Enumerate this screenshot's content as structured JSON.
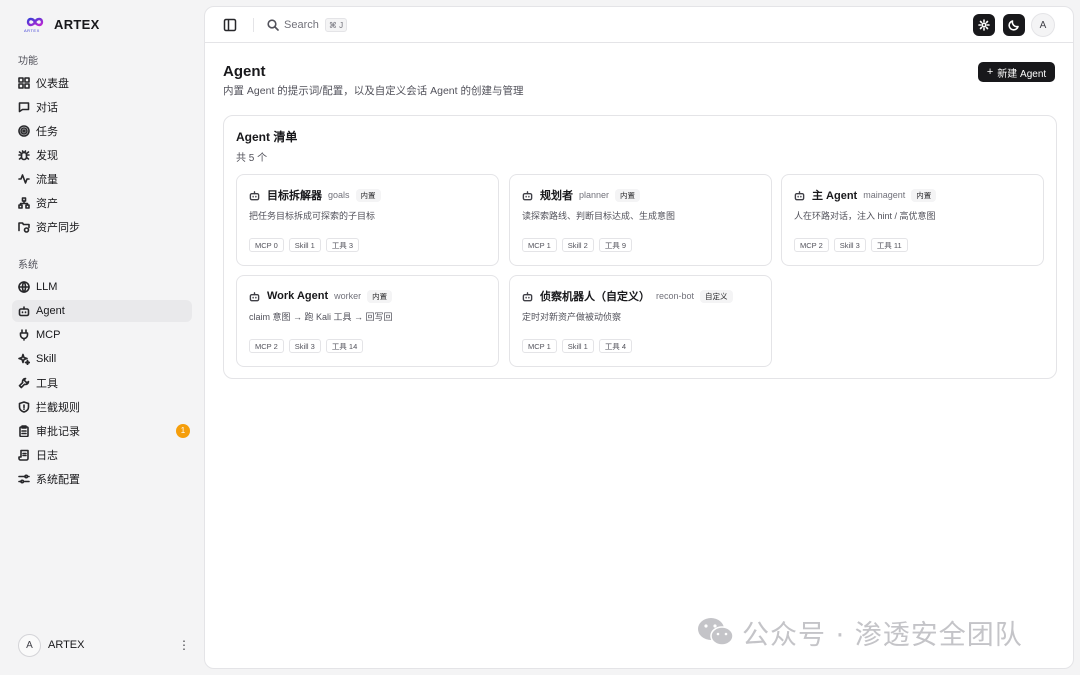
{
  "brand": {
    "name": "ARTEX",
    "logo_caption": "ARTEX"
  },
  "sidebar": {
    "sections": [
      {
        "title": "功能",
        "items": [
          {
            "label": "仪表盘",
            "icon": "dashboard-icon"
          },
          {
            "label": "对话",
            "icon": "chat-icon"
          },
          {
            "label": "任务",
            "icon": "target-icon"
          },
          {
            "label": "发现",
            "icon": "bug-icon"
          },
          {
            "label": "流量",
            "icon": "activity-icon"
          },
          {
            "label": "资产",
            "icon": "network-icon"
          },
          {
            "label": "资产同步",
            "icon": "folder-sync-icon"
          }
        ]
      },
      {
        "title": "系统",
        "items": [
          {
            "label": "LLM",
            "icon": "globe-icon"
          },
          {
            "label": "Agent",
            "icon": "bot-icon",
            "active": true
          },
          {
            "label": "MCP",
            "icon": "plug-icon"
          },
          {
            "label": "Skill",
            "icon": "sparkles-icon"
          },
          {
            "label": "工具",
            "icon": "wrench-icon"
          },
          {
            "label": "拦截规则",
            "icon": "shield-icon"
          },
          {
            "label": "审批记录",
            "icon": "clipboard-icon",
            "badge": "1"
          },
          {
            "label": "日志",
            "icon": "scroll-icon"
          },
          {
            "label": "系统配置",
            "icon": "sliders-icon"
          }
        ]
      }
    ],
    "user": {
      "avatar": "A",
      "name": "ARTEX",
      "menu": "⋮"
    }
  },
  "topbar": {
    "search_label": "Search",
    "search_shortcut": "⌘ J",
    "avatar": "A"
  },
  "page": {
    "title": "Agent",
    "subtitle": "内置 Agent 的提示词/配置，以及自定义会话 Agent 的创建与管理",
    "new_button": "新建 Agent"
  },
  "list": {
    "title": "Agent 清单",
    "count": "共 5 个",
    "agents": [
      {
        "name": "目标拆解器",
        "id": "goals",
        "tag": "内置",
        "desc": "把任务目标拆成可探索的子目标",
        "stats": [
          "MCP 0",
          "Skill 1",
          "工具 3"
        ]
      },
      {
        "name": "规划者",
        "id": "planner",
        "tag": "内置",
        "desc": "读探索路线、判断目标达成、生成意图",
        "stats": [
          "MCP 1",
          "Skill 2",
          "工具 9"
        ]
      },
      {
        "name": "主 Agent",
        "id": "mainagent",
        "tag": "内置",
        "desc": "人在环路对话，注入 hint / 高优意图",
        "stats": [
          "MCP 2",
          "Skill 3",
          "工具 11"
        ]
      },
      {
        "name": "Work Agent",
        "id": "worker",
        "tag": "内置",
        "desc": "claim 意图 → 跑 Kali 工具 → 回写回",
        "stats": [
          "MCP 2",
          "Skill 3",
          "工具 14"
        ]
      },
      {
        "name": "侦察机器人（自定义）",
        "id": "recon-bot",
        "tag": "自定义",
        "desc": "定时对新资产做被动侦察",
        "stats": [
          "MCP 1",
          "Skill 1",
          "工具 4"
        ]
      }
    ]
  },
  "watermark": {
    "text": "公众号 · 渗透安全团队"
  }
}
